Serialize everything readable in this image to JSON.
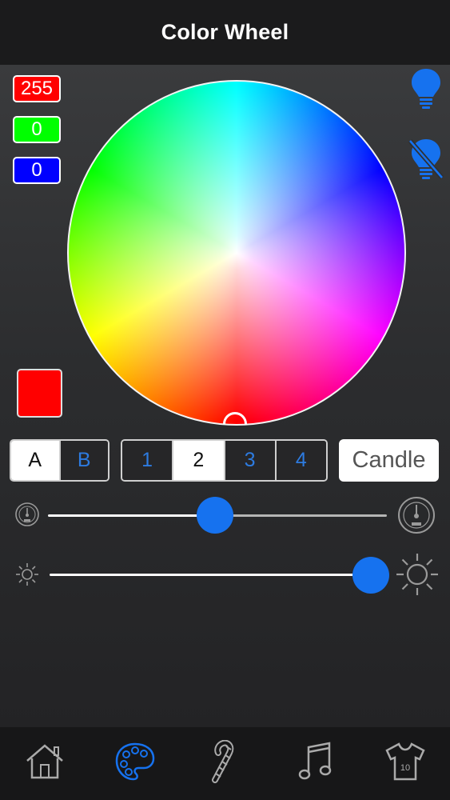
{
  "nav": {
    "title": "Color Wheel"
  },
  "rgb": {
    "r": "255",
    "g": "0",
    "b": "0"
  },
  "colors": {
    "accent": "#1672ef",
    "red_box": "#ff0000",
    "green_box": "#00ff00",
    "blue_box": "#0000ff",
    "swatch": "#ff0000"
  },
  "icons": {
    "light_on": "lightbulb-icon",
    "light_off": "lightbulb-off-icon",
    "speed_slow": "speedometer-slow-icon",
    "speed_fast": "speedometer-fast-icon",
    "brightness_low": "sun-small-icon",
    "brightness_high": "sun-large-icon"
  },
  "zone_selector": {
    "options": [
      "A",
      "B"
    ],
    "selected": "A"
  },
  "channel_selector": {
    "options": [
      "1",
      "2",
      "3",
      "4"
    ],
    "selected": "2"
  },
  "candle": {
    "label": "Candle"
  },
  "speed_slider": {
    "value": 0.49
  },
  "brightness_slider": {
    "value": 1.0
  },
  "tabbar": {
    "items": [
      {
        "name": "home",
        "icon": "home-icon",
        "active": false
      },
      {
        "name": "palette",
        "icon": "palette-icon",
        "active": true
      },
      {
        "name": "candy",
        "icon": "candy-cane-icon",
        "active": false
      },
      {
        "name": "music",
        "icon": "music-note-icon",
        "active": false
      },
      {
        "name": "shirt",
        "icon": "shirt-icon",
        "active": false
      }
    ]
  }
}
